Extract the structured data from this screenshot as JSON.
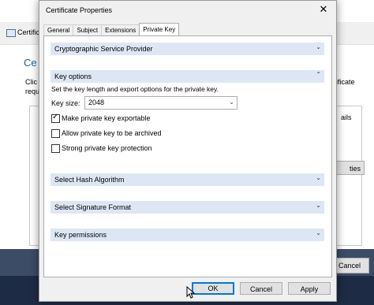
{
  "background_window": {
    "title": "Certific",
    "heading": "Ce",
    "text_line1": "Clic",
    "text_line2": "requ",
    "right_text1": "ificate",
    "right_text2": "ails",
    "side_button_label": "ties",
    "cancel_label": "Cancel"
  },
  "dialog": {
    "title": "Certificate Properties",
    "tabs": [
      {
        "label": "General",
        "active": false
      },
      {
        "label": "Subject",
        "active": false
      },
      {
        "label": "Extensions",
        "active": false
      },
      {
        "label": "Private Key",
        "active": true
      }
    ],
    "sections": {
      "csp": {
        "label": "Cryptographic Service Provider",
        "expanded": false
      },
      "key_options": {
        "label": "Key options",
        "expanded": true
      },
      "hash": {
        "label": "Select Hash Algorithm",
        "expanded": false
      },
      "signature": {
        "label": "Select Signature Format",
        "expanded": false
      },
      "permissions": {
        "label": "Key permissions",
        "expanded": false
      }
    },
    "key_options": {
      "description": "Set the key length and export options for the private key.",
      "key_size_label": "Key size:",
      "key_size_value": "2048",
      "options": [
        {
          "label": "Make private key exportable",
          "checked": true
        },
        {
          "label": "Allow private key to be archived",
          "checked": false
        },
        {
          "label": "Strong private key protection",
          "checked": false
        }
      ]
    },
    "buttons": {
      "ok": "OK",
      "cancel": "Cancel",
      "apply": "Apply"
    }
  },
  "colors": {
    "section_header": "#dde7f4",
    "focus_border": "#0078d7",
    "heading_blue": "#1f5fa8"
  }
}
